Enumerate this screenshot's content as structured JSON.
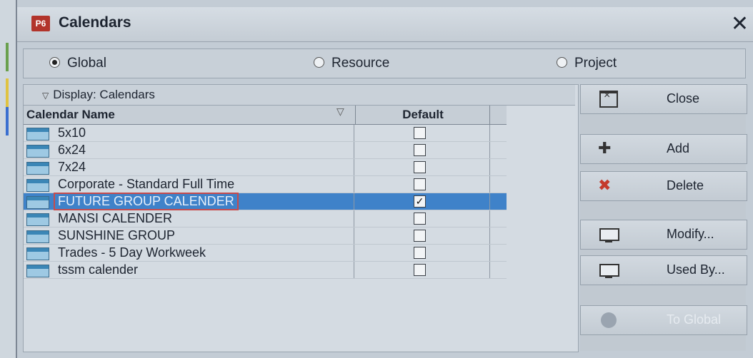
{
  "window": {
    "app_icon": "P6",
    "title": "Calendars",
    "close_glyph": "✕"
  },
  "scope": {
    "options": [
      {
        "label": "Global",
        "selected": true
      },
      {
        "label": "Resource",
        "selected": false
      },
      {
        "label": "Project",
        "selected": false
      }
    ]
  },
  "grid": {
    "display_label": "Display: Calendars",
    "columns": {
      "name": "Calendar Name",
      "default": "Default"
    },
    "rows": [
      {
        "name": "5x10",
        "default": false
      },
      {
        "name": "6x24",
        "default": false
      },
      {
        "name": "7x24",
        "default": false
      },
      {
        "name": "Corporate - Standard Full Time",
        "default": false
      },
      {
        "name": "FUTURE GROUP CALENDER",
        "default": true,
        "selected": true
      },
      {
        "name": "MANSI CALENDER",
        "default": false
      },
      {
        "name": "SUNSHINE GROUP",
        "default": false
      },
      {
        "name": "Trades -  5 Day Workweek",
        "default": false
      },
      {
        "name": "tssm calender",
        "default": false
      }
    ]
  },
  "actions": {
    "close": "Close",
    "add": "Add",
    "delete": "Delete",
    "modify": "Modify...",
    "used_by": "Used By...",
    "to_global": "To Global"
  },
  "icons": {
    "add": "add-icon",
    "delete": "delete-icon",
    "close": "close-window-icon",
    "modify": "monitor-icon",
    "used_by": "monitor-icon",
    "to_global": "globe-icon"
  }
}
